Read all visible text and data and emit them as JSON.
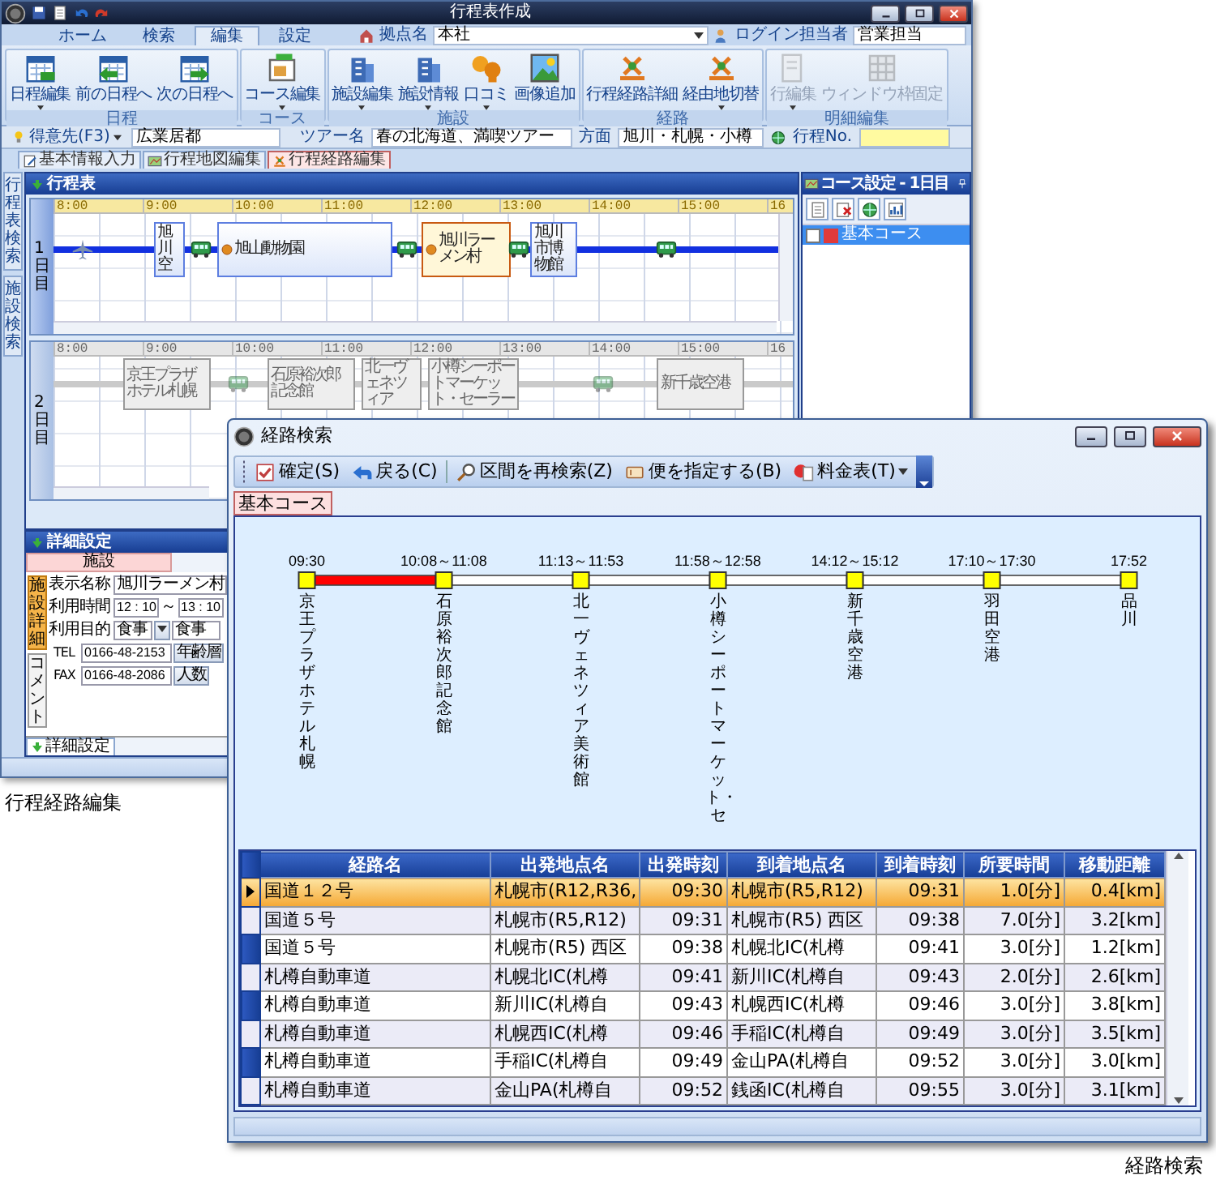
{
  "main_window": {
    "title": "行程表作成",
    "ribbon_tabs": [
      {
        "label": "ホーム",
        "selected": false
      },
      {
        "label": "検索",
        "selected": false
      },
      {
        "label": "編集",
        "selected": true
      },
      {
        "label": "設定",
        "selected": false
      }
    ],
    "branch": {
      "label": "拠点名",
      "value": "本社"
    },
    "login": {
      "label": "ログイン担当者",
      "value": "営業担当"
    },
    "ribbon_groups": [
      {
        "title": "日程",
        "buttons": [
          {
            "label": "日程編集",
            "dropdown": true,
            "disabled": false
          },
          {
            "label": "前の日程へ",
            "dropdown": false,
            "disabled": false
          },
          {
            "label": "次の日程へ",
            "dropdown": false,
            "disabled": false
          }
        ]
      },
      {
        "title": "コース",
        "buttons": [
          {
            "label": "コース編集",
            "dropdown": true,
            "disabled": false
          }
        ]
      },
      {
        "title": "施設",
        "buttons": [
          {
            "label": "施設編集",
            "dropdown": true,
            "disabled": false
          },
          {
            "label": "施設情報",
            "dropdown": true,
            "disabled": false
          },
          {
            "label": "口コミ",
            "dropdown": true,
            "disabled": false
          },
          {
            "label": "画像追加",
            "dropdown": false,
            "disabled": false
          }
        ]
      },
      {
        "title": "経路",
        "buttons": [
          {
            "label": "行程経路詳細",
            "dropdown": false,
            "disabled": false
          },
          {
            "label": "経由地切替",
            "dropdown": true,
            "disabled": false
          }
        ]
      },
      {
        "title": "明細編集",
        "buttons": [
          {
            "label": "行編集",
            "dropdown": true,
            "disabled": true
          },
          {
            "label": "ウィンドウ枠固定",
            "dropdown": false,
            "disabled": true
          }
        ]
      }
    ],
    "info_bar": {
      "customer_label": "得意先(F3)",
      "customer": "広業居都",
      "tour_label": "ツアー名",
      "tour": "春の北海道、満喫ツアー",
      "area_label": "方面",
      "area": "旭川・札幌・小樽",
      "itinerary_no_label": "行程No."
    },
    "doc_tabs": [
      {
        "label": "基本情報入力",
        "selected": false
      },
      {
        "label": "行程地図編集",
        "selected": false
      },
      {
        "label": "行程経路編集",
        "selected": true
      }
    ],
    "side_tabs": [
      {
        "label": "行程表検索"
      },
      {
        "label": "施設検索"
      }
    ],
    "schedule": {
      "title": "行程表",
      "days": [
        {
          "label": "1日目",
          "selected": true,
          "hours": [
            "8:00",
            "9:00",
            "10:00",
            "11:00",
            "12:00",
            "13:00",
            "14:00",
            "15:00",
            "16"
          ],
          "items": [
            {
              "kind": "flight"
            },
            {
              "kind": "place",
              "label": "旭川空",
              "selected": false
            },
            {
              "kind": "transport"
            },
            {
              "kind": "place",
              "label": "旭山動物園",
              "selected": false
            },
            {
              "kind": "transport"
            },
            {
              "kind": "place",
              "label": "旭川ラーメン村",
              "selected": true
            },
            {
              "kind": "transport"
            },
            {
              "kind": "place",
              "label": "旭川市博物館",
              "selected": false
            },
            {
              "kind": "transport"
            }
          ]
        },
        {
          "label": "2日目",
          "selected": false,
          "hours": [
            "8:00",
            "9:00",
            "10:00",
            "11:00",
            "12:00",
            "13:00",
            "14:00",
            "15:00",
            "16"
          ],
          "items": [
            {
              "kind": "place",
              "label": "京王プラザホテル札幌",
              "selected": false
            },
            {
              "kind": "transport"
            },
            {
              "kind": "place",
              "label": "石原裕次郎記念館",
              "selected": false
            },
            {
              "kind": "place",
              "label": "北一ヴェネツィア",
              "selected": false
            },
            {
              "kind": "place",
              "label": "小樽シーポートマーケット・セーラー",
              "selected": false
            },
            {
              "kind": "transport"
            },
            {
              "kind": "place",
              "label": "新千歳空港",
              "selected": false
            }
          ]
        }
      ]
    },
    "course_panel": {
      "title": "コース設定 - 1日目",
      "courses": [
        {
          "label": "基本コース",
          "selected": true,
          "checked": false,
          "color": "#e03a3a"
        }
      ]
    },
    "detail_panel": {
      "title": "詳細設定",
      "tabs": [
        {
          "label": "施設",
          "selected": true
        }
      ],
      "side_tabs": [
        {
          "label": "施設詳細",
          "selected": true
        },
        {
          "label": "コメント",
          "selected": false
        }
      ],
      "name_label": "表示名称",
      "name": "旭川ラーメン村",
      "time_label": "利用時間",
      "time_from": "12 : 10",
      "time_sep": "～",
      "time_to": "13 : 10",
      "purpose_label": "利用目的",
      "purpose": "食事",
      "purpose_detail": "食事",
      "tel_label": "TEL",
      "tel": "0166-48-2153",
      "fax_label": "FAX",
      "fax": "0166-48-2086",
      "buttons": [
        "年齢層",
        "人数"
      ],
      "bottom_tab": "詳細設定"
    },
    "caption": "行程経路編集"
  },
  "route_dialog": {
    "title": "経路検索",
    "toolbar": [
      {
        "label": "確定(S)",
        "dropdown": false
      },
      {
        "label": "戻る(C)",
        "dropdown": false
      },
      {
        "label": "区間を再検索(Z)",
        "dropdown": false
      },
      {
        "label": "便を指定する(B)",
        "dropdown": false
      },
      {
        "label": "料金表(T)",
        "dropdown": true
      }
    ],
    "tabs": [
      {
        "label": "基本コース",
        "selected": true
      }
    ],
    "stops": [
      {
        "time": "09:30",
        "name": "京王プラザホテル札幌"
      },
      {
        "time": "10:08～11:08",
        "name": "石原裕次郎記念館"
      },
      {
        "time": "11:13～11:53",
        "name": "北一ヴェネツィア美術館"
      },
      {
        "time": "11:58～12:58",
        "name": "小樽シーポートマーケット・セ"
      },
      {
        "time": "14:12～15:12",
        "name": "新千歳空港"
      },
      {
        "time": "17:10～17:30",
        "name": "羽田空港"
      },
      {
        "time": "17:52",
        "name": "品川"
      }
    ],
    "segments": [
      {
        "selected": true
      },
      {
        "selected": false
      },
      {
        "selected": false
      },
      {
        "selected": false
      },
      {
        "selected": false
      },
      {
        "selected": false
      }
    ],
    "table": {
      "columns": [
        "経路名",
        "出発地点名",
        "出発時刻",
        "到着地点名",
        "到着時刻",
        "所要時間",
        "移動距離"
      ],
      "rows": [
        {
          "selected": true,
          "cells": [
            "国道１２号",
            "札幌市(R12,R36,",
            "09:30",
            "札幌市(R5,R12)",
            "09:31",
            "1.0[分]",
            "0.4[km]"
          ]
        },
        {
          "selected": false,
          "cells": [
            "国道５号",
            "札幌市(R5,R12)",
            "09:31",
            "札幌市(R5) 西区",
            "09:38",
            "7.0[分]",
            "3.2[km]"
          ]
        },
        {
          "selected": false,
          "cells": [
            "国道５号",
            "札幌市(R5) 西区",
            "09:38",
            "札幌北IC(札樽",
            "09:41",
            "3.0[分]",
            "1.2[km]"
          ]
        },
        {
          "selected": false,
          "cells": [
            "札樽自動車道",
            "札幌北IC(札樽",
            "09:41",
            "新川IC(札樽自",
            "09:43",
            "2.0[分]",
            "2.6[km]"
          ]
        },
        {
          "selected": false,
          "cells": [
            "札樽自動車道",
            "新川IC(札樽自",
            "09:43",
            "札幌西IC(札樽",
            "09:46",
            "3.0[分]",
            "3.8[km]"
          ]
        },
        {
          "selected": false,
          "cells": [
            "札樽自動車道",
            "札幌西IC(札樽",
            "09:46",
            "手稲IC(札樽自",
            "09:49",
            "3.0[分]",
            "3.5[km]"
          ]
        },
        {
          "selected": false,
          "cells": [
            "札樽自動車道",
            "手稲IC(札樽自",
            "09:49",
            "金山PA(札樽自",
            "09:52",
            "3.0[分]",
            "3.0[km]"
          ]
        },
        {
          "selected": false,
          "cells": [
            "札樽自動車道",
            "金山PA(札樽自",
            "09:52",
            "銭函IC(札樽自",
            "09:55",
            "3.0[分]",
            "3.1[km]"
          ]
        }
      ]
    },
    "caption": "経路検索"
  }
}
